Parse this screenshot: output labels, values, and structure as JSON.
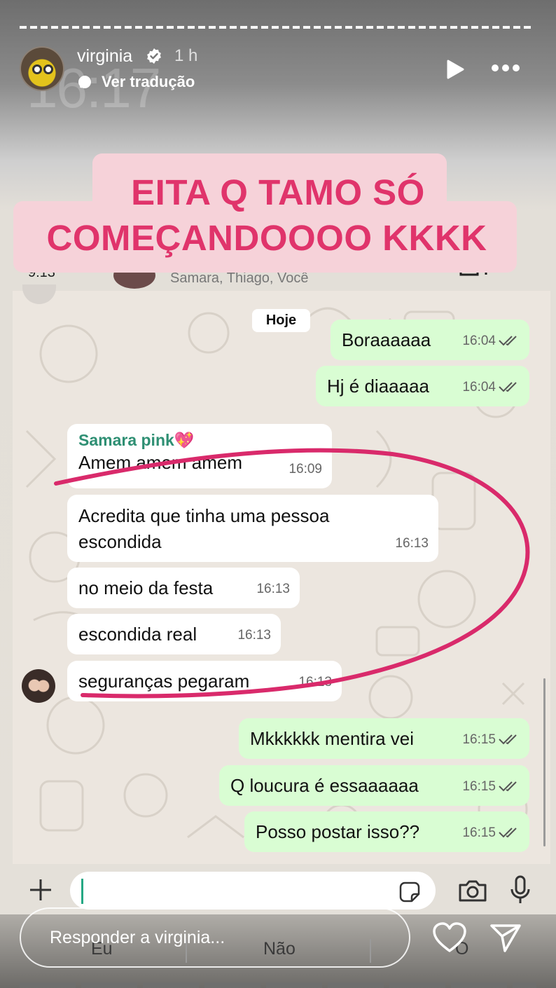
{
  "story": {
    "username": "virginia",
    "time_ago": "1 h",
    "translate_label": "Ver tradução",
    "ghost_clock": "16:17",
    "caption_line1": "EITA Q TAMO SÓ",
    "caption_line2": "COMEÇANDOOOO KKKK",
    "reply_placeholder": "Responder a virginia...",
    "keyboard_peek": [
      "Eu",
      "Não",
      "O"
    ]
  },
  "chat": {
    "members": "Samara, Thiago, Você",
    "peek_time": "9:13",
    "date_chip": "Hoje",
    "messages": [
      {
        "dir": "out",
        "text": "Boraaaaaa",
        "time": "16:04",
        "read": true
      },
      {
        "dir": "out",
        "text": "Hj é diaaaaa",
        "time": "16:04",
        "read": true
      },
      {
        "dir": "in",
        "sender": "Samara pink💖",
        "text": "Amem amem amem",
        "time": "16:09"
      },
      {
        "dir": "in",
        "text": "Acredita que tinha uma pessoa escondida",
        "time": "16:13"
      },
      {
        "dir": "in",
        "text": "no meio da festa",
        "time": "16:13"
      },
      {
        "dir": "in",
        "text": "escondida real",
        "time": "16:13"
      },
      {
        "dir": "in",
        "text": "seguranças pegaram",
        "time": "16:13"
      },
      {
        "dir": "out",
        "text": "Mkkkkkk mentira vei",
        "time": "16:15",
        "read": true
      },
      {
        "dir": "out",
        "text": "Q loucura é essaaaaaa",
        "time": "16:15",
        "read": true
      },
      {
        "dir": "out",
        "text": "Posso postar isso??",
        "time": "16:15",
        "read": true
      }
    ]
  },
  "icons": [
    "verified-badge-icon",
    "translate-icon",
    "play-icon",
    "more-icon",
    "plus-icon",
    "sticker-icon",
    "camera-icon",
    "mic-icon",
    "heart-icon",
    "send-icon"
  ],
  "colors": {
    "caption_text": "#e0346b",
    "caption_bg": "#f6d2d9",
    "outgoing_bubble": "#d9fdd3",
    "sender_name": "#2e8f73",
    "annotation_stroke": "#d92a6b"
  }
}
